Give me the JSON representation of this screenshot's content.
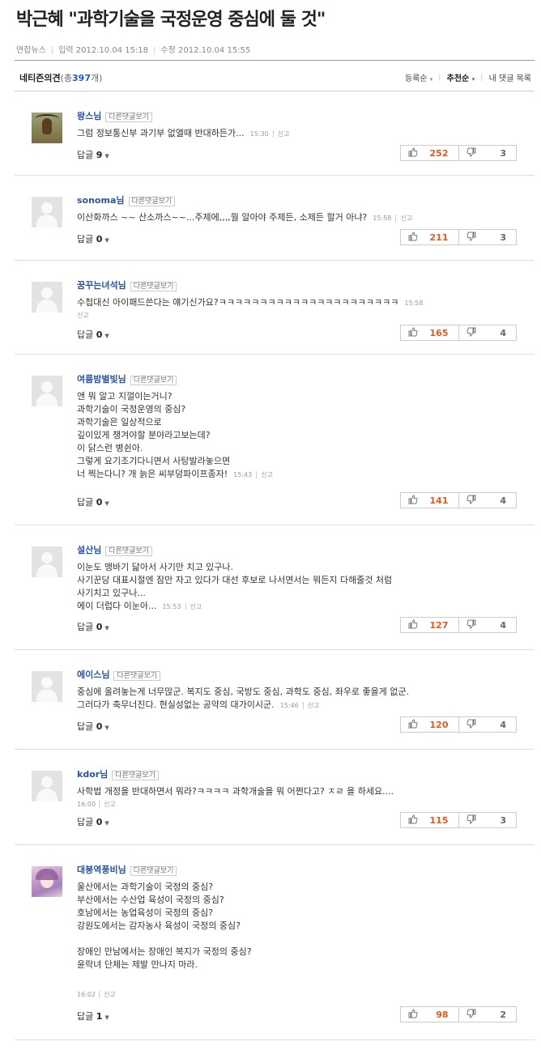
{
  "article": {
    "title": "박근혜 \"과학기술을 국정운영 중심에 둘 것\"",
    "source": "연합뉴스",
    "input_label": "입력",
    "input_time": "2012.10.04 15:18",
    "edit_label": "수정",
    "edit_time": "2012.10.04 15:55"
  },
  "comments_header": {
    "title": "네티즌의견",
    "count_prefix": "(총",
    "count": "397",
    "count_suffix": "개)",
    "sort_options": [
      "등록순",
      "추천순",
      "내 댓글 목록"
    ],
    "active_sort": "추천순"
  },
  "ui": {
    "view_replies": "다른댓글보기",
    "report": "신고",
    "reply_label": "답글"
  },
  "colors": {
    "username": "#2a54a0",
    "upvote": "#e05a1d",
    "count": "#1b5dc2"
  },
  "comments": [
    {
      "user": "왕스님",
      "text": "그럼 정보통신부 과기부 없앨때 반대하든가...",
      "time": "15:30",
      "replies": "9",
      "up": "252",
      "down": "3",
      "avatar": "antelope-photo"
    },
    {
      "user": "sonoma님",
      "text": "이산화까스 ~~ 산소까스~~...주제에,,,,뭘 알아야 주제든, 소제든 할거 아냐?",
      "time": "15:58",
      "replies": "0",
      "up": "211",
      "down": "3",
      "avatar": "default"
    },
    {
      "user": "꿈꾸는녀석님",
      "text": "수첩대신 아이패드쓴다는 얘기신가요?ㅋㅋㅋㅋㅋㅋㅋㅋㅋㅋㅋㅋㅋㅋㅋㅋㅋㅋㅋㅋㅋㅋ",
      "time": "15:58",
      "replies": "0",
      "up": "165",
      "down": "4",
      "avatar": "default"
    },
    {
      "user": "여름밤별빛님",
      "text": "앤 뭐 알고 지껄이는거니?\n과학기술이 국정운영의 중심?\n과학기술은 일상적으로\n깊이있게 챙겨야할 분야라고보는데?\n이 닭스런 병쉰아.\n그렇게 요기조기다니면서 사탕발라놓으면\n너 찍는다니? 개 늙은 씨부덩파이프종자!",
      "time": "15:43",
      "replies": "0",
      "up": "141",
      "down": "4",
      "avatar": "default"
    },
    {
      "user": "설산님",
      "text": "이눈도 맹바기 닮아서 사기만 치고 있구나.\n사기꾼당 대표시절엔 잠만 자고 있다가 대선 후보로 나서면서는 뭐든지 다해줄것 처럼\n사기치고 있구나...\n에이 더럽다 이눈아...",
      "time": "15:53",
      "replies": "0",
      "up": "127",
      "down": "4",
      "avatar": "default"
    },
    {
      "user": "에이스님",
      "text": "중심에 올려놓는게 너무많군. 복지도 중심, 국방도 중심, 과학도 중심, 좌우로 좋을게 없군.\n그러다가 축무너진다. 현실성없는 공약의 대가이시군.",
      "time": "15:46",
      "replies": "0",
      "up": "120",
      "down": "4",
      "avatar": "default"
    },
    {
      "user": "kdor님",
      "text": "사학법 개정을 반대하면서 뭐라?ㅋㅋㅋㅋ 과학개술을 뭐 어쩐다고? ㅈㄹ 을 하세요....",
      "time": "16:00",
      "replies": "0",
      "up": "115",
      "down": "3",
      "avatar": "default"
    },
    {
      "user": "대붕역풍비님",
      "text": "울산에서는 과학기술이 국정의 중심?\n부산에서는 수산업 육성이 국정의 중심?\n호남에서는 농업육성이 국정의 중심?\n강원도에서는 감자농사 육성이 국정의 중심?\n\n장애인 만남에서는 장애인 복지가 국정의 중심?\n윤락녀 단체는 제발 만나지 마라.",
      "time": "16:02",
      "replies": "1",
      "up": "98",
      "down": "2",
      "avatar": "anime-illustration"
    }
  ]
}
